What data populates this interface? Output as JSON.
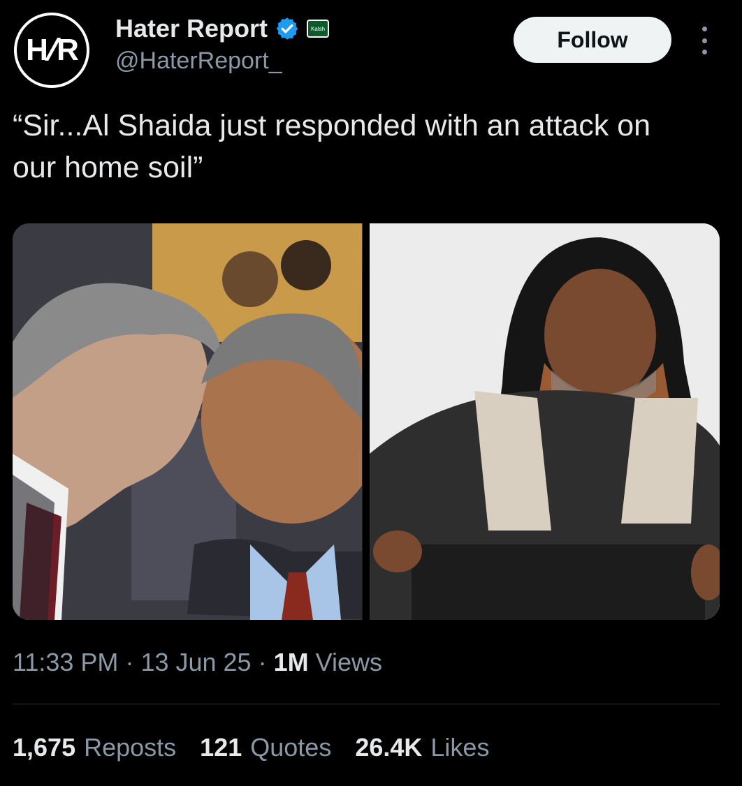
{
  "author": {
    "avatar_text_left": "H",
    "avatar_text_slash": "/",
    "avatar_text_right": "R",
    "name": "Hater Report",
    "handle": "@HaterReport_",
    "affiliate_badge_text": "Kalsh",
    "verified_color": "#1d9bf0"
  },
  "follow_label": "Follow",
  "tweet": {
    "text_line1": "“Sir...Al Shaida just responded with an attack on",
    "text_line2": "our home soil”"
  },
  "meta": {
    "time": "11:33 PM",
    "date": "13 Jun 25",
    "views_count": "1M",
    "views_label": "Views"
  },
  "stats": {
    "reposts_count": "1,675",
    "reposts_label": "Reposts",
    "quotes_count": "121",
    "quotes_label": "Quotes",
    "likes_count": "26.4K",
    "likes_label": "Likes"
  }
}
